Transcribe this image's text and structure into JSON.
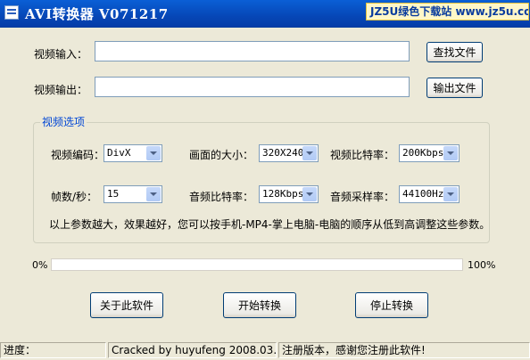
{
  "window": {
    "title": "AVI转换器 V071217",
    "watermark": "JZ5U绿色下载站 www.jz5u.com"
  },
  "input": {
    "label": "视频输入：",
    "value": "",
    "browse_label": "查找文件"
  },
  "output": {
    "label": "视频输出：",
    "value": "",
    "browse_label": "输出文件"
  },
  "options": {
    "group_title": "视频选项",
    "video_codec": {
      "label": "视频编码：",
      "value": "DivX"
    },
    "frame_size": {
      "label": "画面的大小：",
      "value": "320X240"
    },
    "video_bitrate": {
      "label": "视频比特率：",
      "value": "200Kbps"
    },
    "fps": {
      "label": "帧数/秒：",
      "value": "15"
    },
    "audio_bitrate": {
      "label": "音频比特率：",
      "value": "128Kbps"
    },
    "audio_samplerate": {
      "label": "音频采样率：",
      "value": "44100Hz"
    },
    "hint": "以上参数越大，效果越好，您可以按手机-MP4-掌上电脑-电脑的顺序从低到高调整这些参数。"
  },
  "progress": {
    "min_label": "0%",
    "max_label": "100%",
    "value_percent": 0
  },
  "buttons": {
    "about": "关于此软件",
    "start": "开始转换",
    "stop": "停止转换"
  },
  "status": {
    "progress_label": "进度：",
    "cracked": "Cracked by huyufeng 2008.03.",
    "registered": "注册版本，感谢您注册此软件!"
  },
  "colors": {
    "title_bar": "#0A5FD6",
    "group_title": "#0046D5",
    "dialog_bg": "#ECE9D8"
  }
}
